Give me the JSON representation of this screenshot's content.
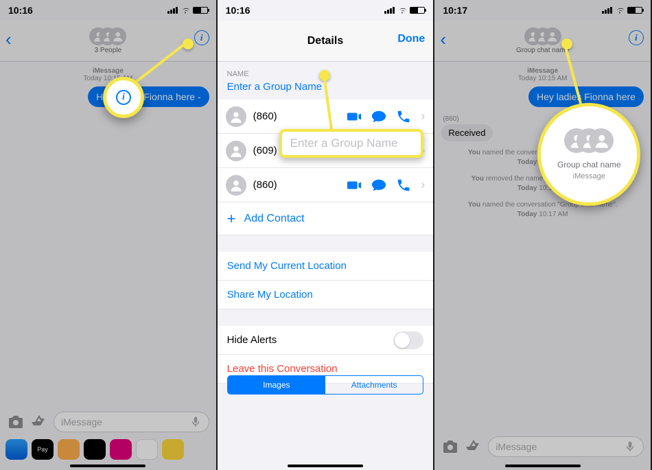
{
  "panel1": {
    "time": "10:16",
    "group_label": "3 People",
    "meta_label": "iMessage",
    "meta_time": "Today 10:15 AM",
    "bubble": "Hey ladies Fionna here -",
    "input_placeholder": "iMessage"
  },
  "panel2": {
    "time": "10:16",
    "title": "Details",
    "done": "Done",
    "name_section": "NAME",
    "name_placeholder": "Enter a Group Name",
    "contacts": [
      {
        "num": "(860)"
      },
      {
        "num": "(609)"
      },
      {
        "num": "(860)"
      }
    ],
    "add_contact": "Add Contact",
    "send_location": "Send My Current Location",
    "share_location": "Share My Location",
    "hide_alerts": "Hide Alerts",
    "leave": "Leave this Conversation",
    "seg_images": "Images",
    "seg_attachments": "Attachments",
    "callout_label": "Enter a Group Name"
  },
  "panel3": {
    "time": "10:17",
    "group_label": "Group chat name",
    "meta_label": "iMessage",
    "meta_time": "Today 10:15 AM",
    "bubble": "Hey ladies Fionna here",
    "recv_num": "(860)",
    "recv_label": "Received",
    "sys1_pre": "You",
    "sys1_mid": " named the conversation \"Group chat name\".",
    "sys1_time": "Today 10:16 AM",
    "sys2_pre": "You",
    "sys2_mid": " removed the name from this conversation.",
    "sys2_time": "Today 10:16 AM",
    "sys3_pre": "You",
    "sys3_mid": " named the conversation \"Group chat name\".",
    "sys3_time": "Today 10:17 AM",
    "input_placeholder": "iMessage",
    "callout_label": "Group chat name",
    "callout_sub": "iMessage"
  }
}
